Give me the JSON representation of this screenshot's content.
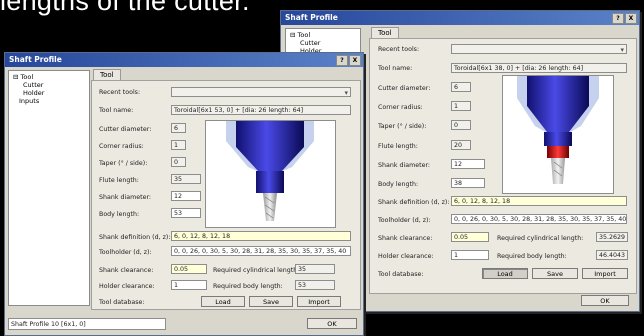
{
  "caption": "lengths of the cutter.",
  "front": {
    "title": "Shaft Profile",
    "controls": [
      "?",
      "X"
    ],
    "tree": {
      "root": "Tool",
      "children": [
        "Cutter",
        "Holder"
      ],
      "sibling": "Inputs"
    },
    "tab": "Tool",
    "labels": {
      "recent_tools": "Recent tools:",
      "tool_name": "Tool name:",
      "cutter_diameter": "Cutter diameter:",
      "corner_radius": "Corner radius:",
      "taper": "Taper (° / side):",
      "flute_length": "Flute length:",
      "shank_diameter": "Shank diameter:",
      "body_length": "Body length:",
      "shank_definition": "Shank definition (d, z):",
      "toolholder": "Toolholder (d, z):",
      "shank_clearance": "Shank clearance:",
      "holder_clearance": "Holder clearance:",
      "tool_database": "Tool database:",
      "req_cyl_length": "Required cylindrical length:",
      "req_body_length": "Required body length:"
    },
    "values": {
      "tool_name": "Toroidal[6x1 53, 0] + [dia: 26 length: 64]",
      "cutter_diameter": "6",
      "corner_radius": "1",
      "taper": "0",
      "flute_length": "35",
      "shank_diameter": "12",
      "body_length": "53",
      "shank_definition": "6, 0, 12, 8, 12, 18",
      "toolholder": "0, 0, 26, 0, 30, 5, 30, 28, 31, 28, 35, 30, 35, 37, 35, 40",
      "shank_clearance": "0.05",
      "holder_clearance": "1",
      "req_cyl_length": "35",
      "req_body_length": "53"
    },
    "buttons": {
      "load": "Load",
      "save": "Save",
      "import": "Import",
      "ok": "OK"
    },
    "status": "Shaft Profile 10 [6x1, 0]"
  },
  "back": {
    "title": "Shaft Profile",
    "controls": [
      "?",
      "X"
    ],
    "tree": {
      "root": "Tool",
      "children": [
        "Cutter",
        "Holder"
      ]
    },
    "tab": "Tool",
    "labels": {
      "recent_tools": "Recent tools:",
      "tool_name": "Tool name:",
      "cutter_diameter": "Cutter diameter:",
      "corner_radius": "Corner radius:",
      "taper": "Taper (° / side):",
      "flute_length": "Flute length:",
      "shank_diameter": "Shank diameter:",
      "body_length": "Body length:",
      "shank_definition": "Shank definition (d, z):",
      "toolholder": "Toolholder (d, z):",
      "shank_clearance": "Shank clearance:",
      "holder_clearance": "Holder clearance:",
      "tool_database": "Tool database:",
      "req_cyl_length": "Required cylindrical length:",
      "req_body_length": "Required body length:"
    },
    "values": {
      "tool_name": "Toroidal[6x1 38, 0] + [dia: 26 length: 64]",
      "cutter_diameter": "6",
      "corner_radius": "1",
      "taper": "0",
      "flute_length": "20",
      "shank_diameter": "12",
      "body_length": "38",
      "shank_definition": "6, 0, 12, 8, 12, 18",
      "toolholder": "0, 0, 26, 0, 30, 5, 30, 28, 31, 28, 35, 30, 35, 37, 35, 40",
      "shank_clearance": "0.05",
      "holder_clearance": "1",
      "req_cyl_length": "35.2629",
      "req_body_length": "46.4043"
    },
    "buttons": {
      "load": "Load",
      "save": "Save",
      "import": "Import",
      "ok": "OK"
    }
  }
}
